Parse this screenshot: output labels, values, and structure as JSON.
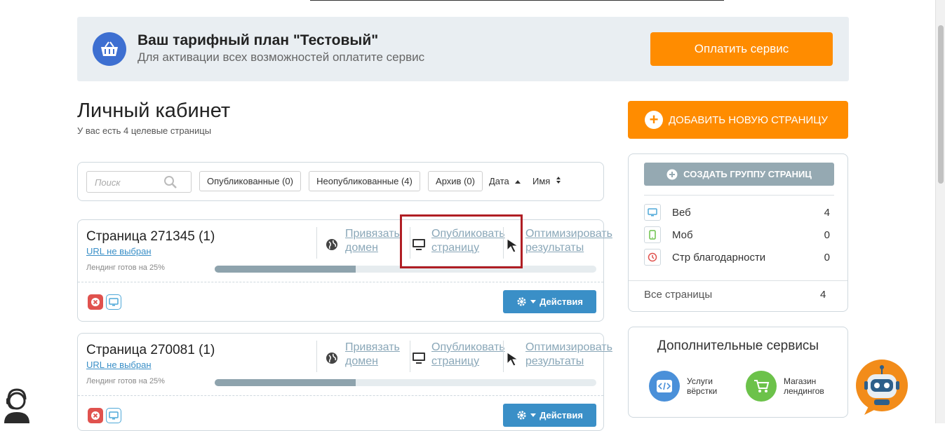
{
  "banner": {
    "title": "Ваш тарифный план \"Тестовый\"",
    "subtitle": "Для активации всех возможностей оплатите сервис",
    "pay_label": "Оплатить сервис"
  },
  "header": {
    "title": "Личный кабинет",
    "subtitle": "У вас есть 4 целевые страницы"
  },
  "filters": {
    "search_placeholder": "Поиск",
    "published": "Опубликованные (0)",
    "unpublished": "Неопубликованные (4)",
    "archive": "Архив (0)",
    "sort_date": "Дата",
    "sort_name": "Имя"
  },
  "pages": [
    {
      "name": "Страница 271345 (1)",
      "url": "URL не выбран",
      "ready_text": "Лендинг готов на 25%",
      "progress": 0.37,
      "bind_domain": "Привязать\nдомен",
      "publish": "Опубликовать\nстраницу",
      "optimize": "Оптимизировать\nрезультаты",
      "actions_label": "Действия"
    },
    {
      "name": "Страница 270081 (1)",
      "url": "URL не выбран",
      "ready_text": "Лендинг готов на 25%",
      "progress": 0.37,
      "bind_domain": "Привязать\nдомен",
      "publish": "Опубликовать\nстраницу",
      "optimize": "Оптимизировать\nрезультаты",
      "actions_label": "Действия"
    }
  ],
  "sidebar": {
    "add_page_label": "ДОБАВИТЬ НОВУЮ СТРАНИЦУ",
    "create_group_label": "СОЗДАТЬ ГРУППУ СТРАНИЦ",
    "groups": [
      {
        "label": "Веб",
        "count": "4"
      },
      {
        "label": "Моб",
        "count": "0"
      },
      {
        "label": "Стр благодарности",
        "count": "0"
      }
    ],
    "all_pages_label": "Все страницы",
    "all_pages_count": "4",
    "services_title": "Дополнительные сервисы",
    "services": [
      {
        "label": "Услуги\nвёрстки"
      },
      {
        "label": "Магазин\nлендингов"
      }
    ]
  },
  "colors": {
    "accent_orange": "#ff8c00",
    "primary_blue": "#3a8fc7",
    "highlight_red": "#b01e24"
  }
}
